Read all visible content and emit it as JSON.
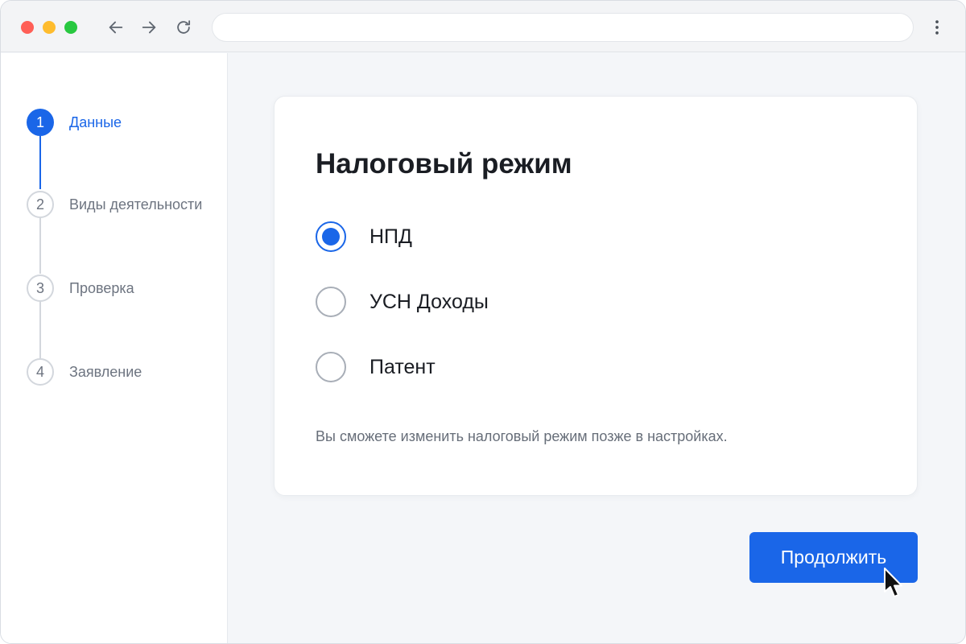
{
  "browser": {
    "address_value": "",
    "icons": {
      "back": "arrow-left-icon",
      "forward": "arrow-right-icon",
      "reload": "reload-icon",
      "menu": "kebab-menu-icon"
    }
  },
  "steps": [
    {
      "number": "1",
      "label": "Данные",
      "state": "active"
    },
    {
      "number": "2",
      "label": "Виды деятельности",
      "state": "inactive"
    },
    {
      "number": "3",
      "label": "Проверка",
      "state": "inactive"
    },
    {
      "number": "4",
      "label": "Заявление",
      "state": "inactive"
    }
  ],
  "card": {
    "title": "Налоговый режим",
    "options": [
      {
        "label": "НПД",
        "selected": true
      },
      {
        "label": "УСН Доходы",
        "selected": false
      },
      {
        "label": "Патент",
        "selected": false
      }
    ],
    "hint": "Вы сможете изменить налоговый режим позже в настройках."
  },
  "actions": {
    "continue_label": "Продолжить"
  },
  "colors": {
    "accent": "#1a66e8",
    "inactive_step": "#d3d7dd",
    "page_background": "#f4f6f9"
  }
}
